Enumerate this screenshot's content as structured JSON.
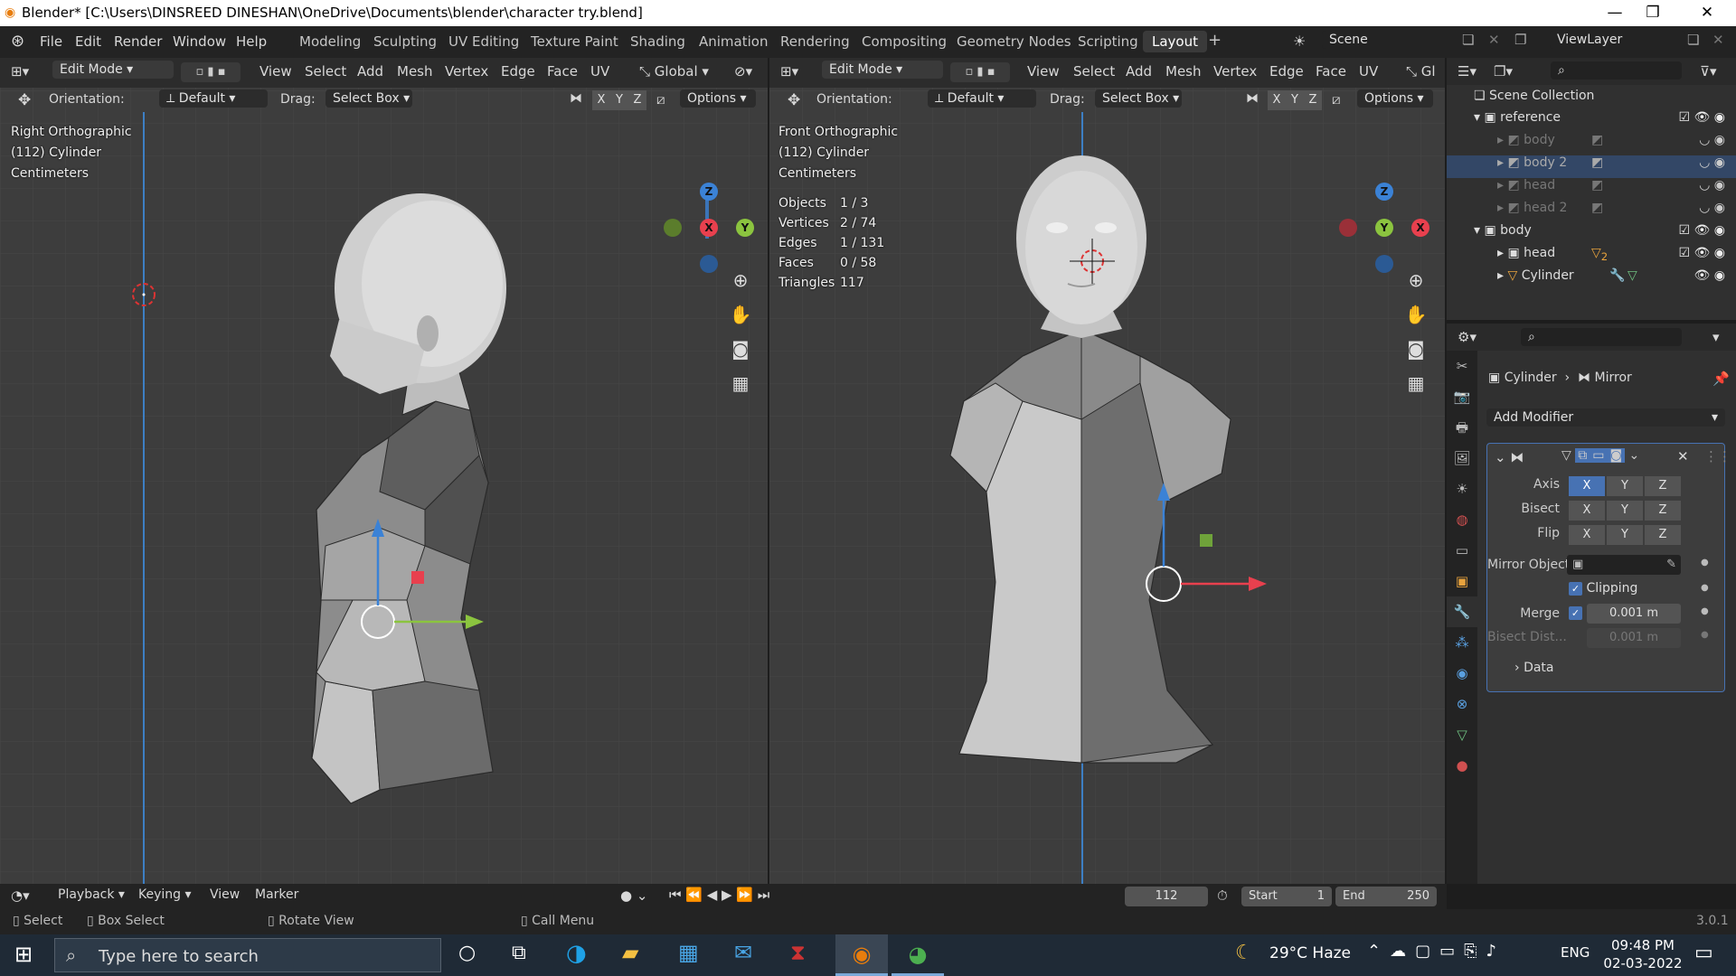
{
  "title": "Blender* [C:\\Users\\DINSREED DINESHAN\\OneDrive\\Documents\\blender\\character try.blend]",
  "window_controls": {
    "minimize": "—",
    "maximize": "❐",
    "close": "✕"
  },
  "menu": {
    "file": "File",
    "edit": "Edit",
    "render": "Render",
    "window": "Window",
    "help": "Help"
  },
  "workspaces": [
    "Modeling",
    "Sculpting",
    "UV Editing",
    "Texture Paint",
    "Shading",
    "Animation",
    "Rendering",
    "Compositing",
    "Geometry Nodes",
    "Scripting",
    "Layout"
  ],
  "workspace_add": "+",
  "scene": {
    "label": "Scene"
  },
  "view_layer": {
    "label": "ViewLayer"
  },
  "left_viewport": {
    "mode": "Edit Mode",
    "menus": [
      "View",
      "Select",
      "Add",
      "Mesh",
      "Vertex",
      "Edge",
      "Face",
      "UV"
    ],
    "transform": "Global",
    "orientation_label": "Orientation:",
    "orientation": "Default",
    "drag_label": "Drag:",
    "drag": "Select Box",
    "axes": [
      "X",
      "Y",
      "Z"
    ],
    "options": "Options",
    "overlay": {
      "view": "Right Orthographic",
      "object": "(112) Cylinder",
      "units": "Centimeters"
    },
    "gizmo": {
      "z": "Z",
      "x": "X",
      "y": "Y"
    }
  },
  "right_viewport": {
    "mode": "Edit Mode",
    "menus": [
      "View",
      "Select",
      "Add",
      "Mesh",
      "Vertex",
      "Edge",
      "Face",
      "UV"
    ],
    "transform_cut": "Gl",
    "orientation_label": "Orientation:",
    "orientation": "Default",
    "drag_label": "Drag:",
    "drag": "Select Box",
    "axes": [
      "X",
      "Y",
      "Z"
    ],
    "options": "Options",
    "overlay": {
      "view": "Front Orthographic",
      "object": "(112) Cylinder",
      "units": "Centimeters"
    },
    "stats": [
      {
        "label": "Objects",
        "value": "1 / 3"
      },
      {
        "label": "Vertices",
        "value": "2 / 74"
      },
      {
        "label": "Edges",
        "value": "1 / 131"
      },
      {
        "label": "Faces",
        "value": "0 / 58"
      },
      {
        "label": "Triangles",
        "value": "117"
      }
    ],
    "gizmo": {
      "z": "Z",
      "x": "X",
      "y": "Y"
    }
  },
  "outliner": {
    "root": "Scene Collection",
    "rows": [
      {
        "name": "reference",
        "depth": 1
      },
      {
        "name": "body",
        "depth": 2
      },
      {
        "name": "body 2",
        "depth": 2
      },
      {
        "name": "head",
        "depth": 2
      },
      {
        "name": "head 2",
        "depth": 2
      },
      {
        "name": "body",
        "depth": 1
      },
      {
        "name": "head",
        "depth": 2
      },
      {
        "name": "Cylinder",
        "depth": 2
      }
    ],
    "badge": "2"
  },
  "properties": {
    "breadcrumb_object": "Cylinder",
    "breadcrumb_modifier": "Mirror",
    "add_modifier": "Add Modifier",
    "axis_label": "Axis",
    "bisect_label": "Bisect",
    "flip_label": "Flip",
    "xyz": [
      "X",
      "Y",
      "Z"
    ],
    "mirror_object_label": "Mirror Object",
    "clipping_label": "Clipping",
    "merge_label": "Merge",
    "merge_value": "0.001 m",
    "bisect_dist_label": "Bisect Dist...",
    "bisect_dist_value": "0.001 m",
    "data_label": "Data"
  },
  "timeline": {
    "playback": "Playback",
    "keying": "Keying",
    "view": "View",
    "marker": "Marker",
    "frame": "112",
    "start_label": "Start",
    "start": "1",
    "end_label": "End",
    "end": "250"
  },
  "status": {
    "select": "Select",
    "box_select": "Box Select",
    "rotate_view": "Rotate View",
    "call_menu": "Call Menu",
    "version": "3.0.1"
  },
  "taskbar": {
    "search_placeholder": "Type here to search",
    "weather": "29°C  Haze",
    "lang": "ENG",
    "time": "09:48 PM",
    "date": "02-03-2022"
  },
  "colors": {
    "accent": "#4772b3",
    "x_axis": "#e8404e",
    "y_axis": "#8bc43f",
    "z_axis": "#3b82d6",
    "viewport_bg": "#3d3d3d"
  }
}
